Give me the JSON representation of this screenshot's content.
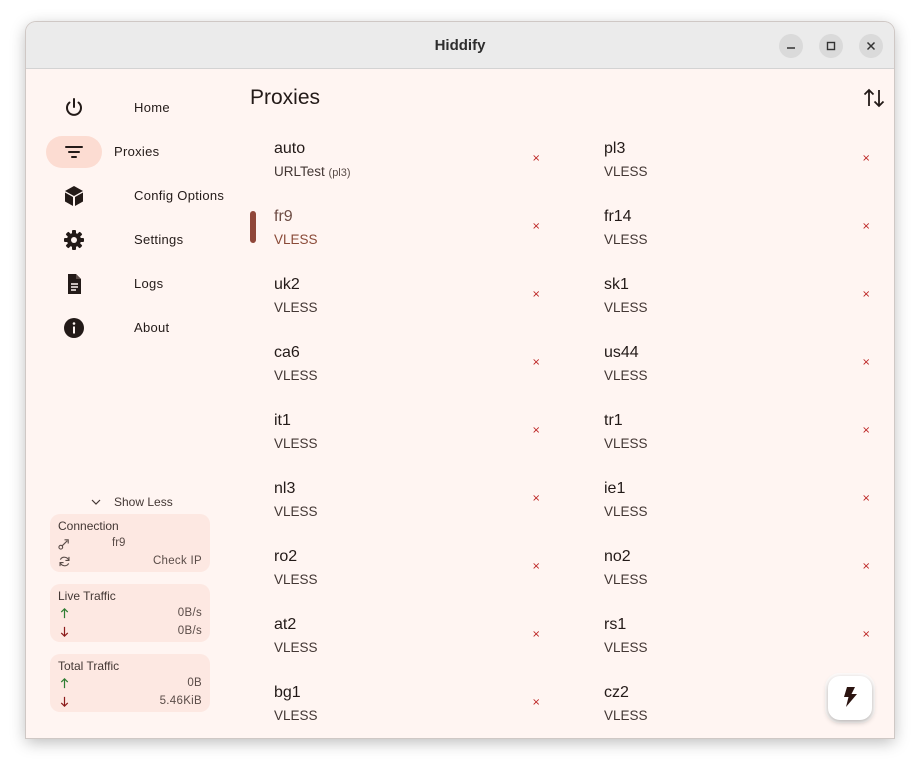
{
  "window": {
    "title": "Hiddify"
  },
  "sidebar": {
    "items": [
      {
        "label": "Home",
        "icon": "power-icon",
        "selected": false
      },
      {
        "label": "Proxies",
        "icon": "filter-list-icon",
        "selected": true
      },
      {
        "label": "Config Options",
        "icon": "cube-icon",
        "selected": false
      },
      {
        "label": "Settings",
        "icon": "gear-icon",
        "selected": false
      },
      {
        "label": "Logs",
        "icon": "document-icon",
        "selected": false
      },
      {
        "label": "About",
        "icon": "info-icon",
        "selected": false
      }
    ],
    "show_less_label": "Show Less",
    "connection": {
      "title": "Connection",
      "proxy": "fr9",
      "check_ip_label": "Check IP"
    },
    "live_traffic": {
      "title": "Live Traffic",
      "upload": "0B/s",
      "download": "0B/s"
    },
    "total_traffic": {
      "title": "Total Traffic",
      "upload": "0B",
      "download": "5.46KiB"
    }
  },
  "main": {
    "title": "Proxies",
    "proxies": [
      {
        "name": "auto",
        "type": "URLTest",
        "sub": "(pl3)",
        "delay": "×",
        "selected": false
      },
      {
        "name": "pl3",
        "type": "VLESS",
        "delay": "×",
        "selected": false
      },
      {
        "name": "fr9",
        "type": "VLESS",
        "delay": "×",
        "selected": true
      },
      {
        "name": "fr14",
        "type": "VLESS",
        "delay": "×",
        "selected": false
      },
      {
        "name": "uk2",
        "type": "VLESS",
        "delay": "×",
        "selected": false
      },
      {
        "name": "sk1",
        "type": "VLESS",
        "delay": "×",
        "selected": false
      },
      {
        "name": "ca6",
        "type": "VLESS",
        "delay": "×",
        "selected": false
      },
      {
        "name": "us44",
        "type": "VLESS",
        "delay": "×",
        "selected": false
      },
      {
        "name": "it1",
        "type": "VLESS",
        "delay": "×",
        "selected": false
      },
      {
        "name": "tr1",
        "type": "VLESS",
        "delay": "×",
        "selected": false
      },
      {
        "name": "nl3",
        "type": "VLESS",
        "delay": "×",
        "selected": false
      },
      {
        "name": "ie1",
        "type": "VLESS",
        "delay": "×",
        "selected": false
      },
      {
        "name": "ro2",
        "type": "VLESS",
        "delay": "×",
        "selected": false
      },
      {
        "name": "no2",
        "type": "VLESS",
        "delay": "×",
        "selected": false
      },
      {
        "name": "at2",
        "type": "VLESS",
        "delay": "×",
        "selected": false
      },
      {
        "name": "rs1",
        "type": "VLESS",
        "delay": "×",
        "selected": false
      },
      {
        "name": "bg1",
        "type": "VLESS",
        "delay": "×",
        "selected": false
      },
      {
        "name": "cz2",
        "type": "VLESS",
        "delay": "×",
        "selected": false
      }
    ]
  },
  "colors": {
    "background": "#fff5f2",
    "selected_nav": "#fcdcd2",
    "selected_bar": "#90473a",
    "error": "#ba1a1a",
    "upload_arrow": "#2e7d32",
    "download_arrow": "#8b1a1a"
  }
}
